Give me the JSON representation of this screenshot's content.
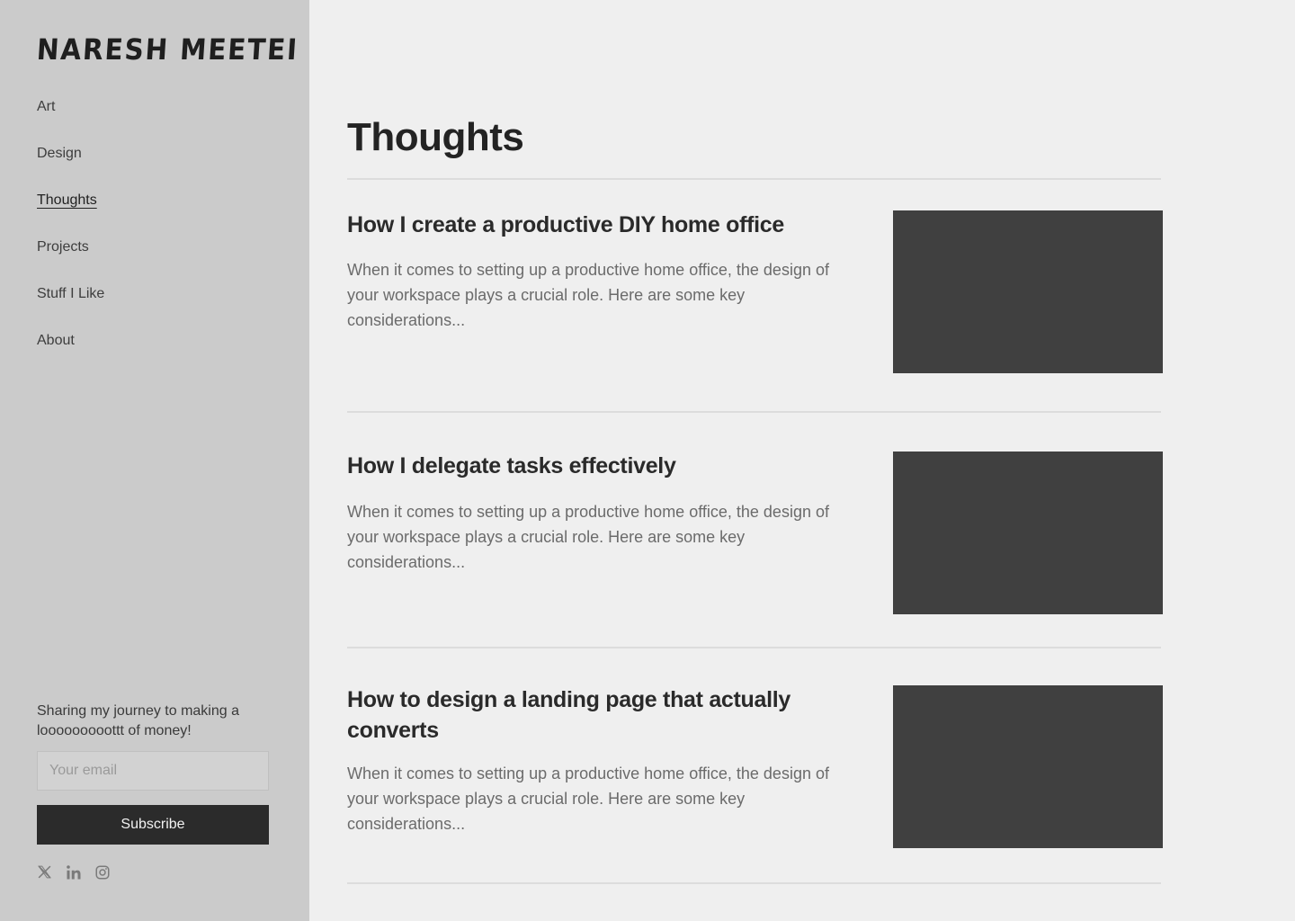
{
  "sidebar": {
    "logo": "NARESH MEETEI",
    "nav": [
      {
        "label": "Art"
      },
      {
        "label": "Design"
      },
      {
        "label": "Thoughts",
        "active": true
      },
      {
        "label": "Projects"
      },
      {
        "label": "Stuff I Like"
      },
      {
        "label": "About"
      }
    ],
    "newsletter": {
      "text": "Sharing my journey to making a looooooooottt of money!",
      "email_placeholder": "Your email",
      "email_value": "",
      "button_label": "Subscribe"
    },
    "socials": [
      {
        "icon": "x-icon"
      },
      {
        "icon": "linkedin-icon"
      },
      {
        "icon": "instagram-icon"
      }
    ]
  },
  "main": {
    "title": "Thoughts",
    "posts": [
      {
        "title": "How I create a productive DIY home office",
        "excerpt": "When it comes to setting up a productive home office, the design of your workspace plays a crucial role. Here are some key considerations..."
      },
      {
        "title": "How I delegate tasks effectively",
        "excerpt": "When it comes to setting up a productive home office, the design of your workspace plays a crucial role. Here are some key considerations..."
      },
      {
        "title": "How to design a landing page that actually converts",
        "excerpt": "When it comes to setting up a productive home office, the design of your workspace plays a crucial role. Here are some key considerations..."
      }
    ]
  },
  "colors": {
    "sidebar_bg": "#cbcbcb",
    "page_bg": "#efefef",
    "button_bg": "#2b2b2b",
    "thumbnail_bg": "#404040",
    "text_dark": "#2b2b2b",
    "text_muted": "#6b6b6b"
  }
}
